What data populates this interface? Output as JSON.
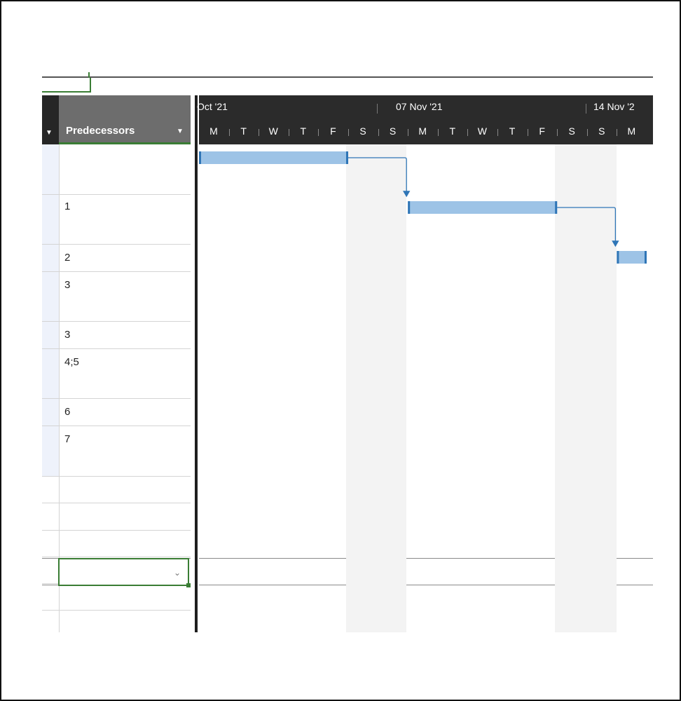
{
  "grid": {
    "column_header": "Predecessors",
    "dropdown_glyph": "▼",
    "rows": [
      {
        "pred": ""
      },
      {
        "pred": "1"
      },
      {
        "pred": "2"
      },
      {
        "pred": "3"
      },
      {
        "pred": "3"
      },
      {
        "pred": "4;5"
      },
      {
        "pred": "6"
      },
      {
        "pred": "7"
      }
    ],
    "selected_cell_value": ""
  },
  "timescale": {
    "weeks": [
      "Oct '21",
      "07 Nov '21",
      "14 Nov '2"
    ],
    "days": [
      "M",
      "T",
      "W",
      "T",
      "F",
      "S",
      "S",
      "M",
      "T",
      "W",
      "T",
      "F",
      "S",
      "S",
      "M"
    ]
  },
  "chart_data": {
    "type": "gantt",
    "bars": [
      {
        "task": 1,
        "start_day_index": 0,
        "end_day_index": 5
      },
      {
        "task": 2,
        "start_day_index": 7,
        "end_day_index": 12
      },
      {
        "task": 3,
        "start_day_index": 14,
        "end_day_index": 15
      }
    ],
    "links": [
      {
        "from": 1,
        "to": 2
      },
      {
        "from": 2,
        "to": 3
      }
    ],
    "bar_color": "#9dc3e6",
    "bar_edge_color": "#2e75b6"
  },
  "icons": {
    "header_dropdown": "chevron-down-icon",
    "cell_dropdown": "chevron-down-icon"
  }
}
